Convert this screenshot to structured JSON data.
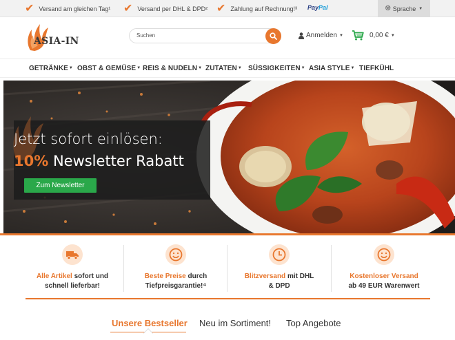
{
  "topbar": {
    "usps": [
      "Versand am gleichen Tag¹",
      "Versand per DHL & DPD²",
      "Zahlung auf Rechnung!³"
    ],
    "paypal_1": "Pay",
    "paypal_2": "Pal",
    "language_label": "Sprache"
  },
  "header": {
    "logo_text": "Asia-In",
    "search_placeholder": "Suchen",
    "login_label": "Anmelden",
    "cart_amount": "0,00 €"
  },
  "nav": {
    "items": [
      {
        "label": "GETRÄNKE",
        "dropdown": true
      },
      {
        "label": "OBST & GEMÜSE",
        "dropdown": true
      },
      {
        "label": "REIS & NUDELN",
        "dropdown": true
      },
      {
        "label": "ZUTATEN",
        "dropdown": true
      },
      {
        "label": "SÜSSIGKEITEN",
        "dropdown": true
      },
      {
        "label": "ASIA STYLE",
        "dropdown": true
      },
      {
        "label": "TIEFKÜHL",
        "dropdown": false
      }
    ]
  },
  "hero": {
    "line1": "Jetzt sofort einlösen:",
    "percent": "10%",
    "line2_rest": " Newsletter Rabatt",
    "button": "Zum Newsletter"
  },
  "features": [
    {
      "icon": "truck-icon",
      "highlight": "Alle Artikel",
      "rest1": " sofort und",
      "line2": "schnell lieferbar!"
    },
    {
      "icon": "smiley-icon",
      "highlight": "Beste Preise",
      "rest1": " durch",
      "line2": "Tiefpreisgarantie!⁴"
    },
    {
      "icon": "clock-icon",
      "highlight": "Blitzversand",
      "rest1": " mit DHL",
      "line2": "& DPD"
    },
    {
      "icon": "smiley-icon",
      "highlight": "Kostenloser Versand",
      "rest1": "",
      "line2": "ab 49 EUR Warenwert"
    }
  ],
  "tabs": [
    "Unsere Bestseller",
    "Neu im Sortiment!",
    "Top Angebote"
  ],
  "colors": {
    "accent": "#e8772e",
    "green": "#2aa84a",
    "topbar_bg": "#f2f2f2"
  }
}
